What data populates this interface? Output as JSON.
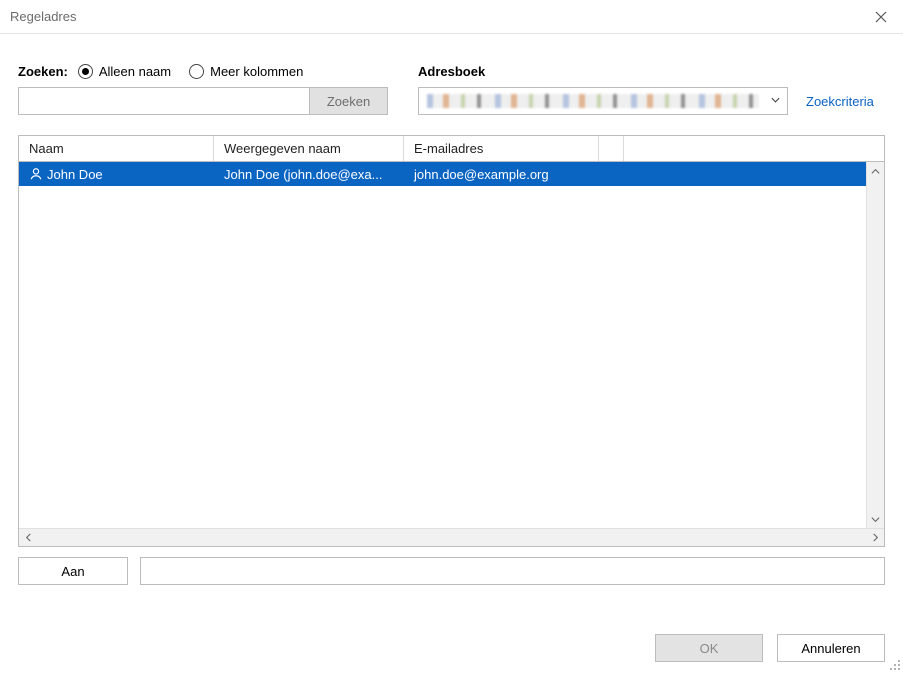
{
  "window": {
    "title": "Regeladres"
  },
  "search": {
    "label": "Zoeken:",
    "radio_only_name": "Alleen naam",
    "radio_more_columns": "Meer kolommen",
    "input_value": "",
    "button": "Zoeken"
  },
  "addressbook": {
    "label": "Adresboek",
    "criteria_link": "Zoekcriteria"
  },
  "columns": {
    "name": "Naam",
    "display_name": "Weergegeven naam",
    "email": "E-mailadres"
  },
  "rows": [
    {
      "name": "John Doe",
      "display_name": "John Doe (john.doe@exa...",
      "email": "john.doe@example.org",
      "selected": true
    }
  ],
  "to": {
    "button": "Aan",
    "value": ""
  },
  "footer": {
    "ok": "OK",
    "cancel": "Annuleren"
  }
}
